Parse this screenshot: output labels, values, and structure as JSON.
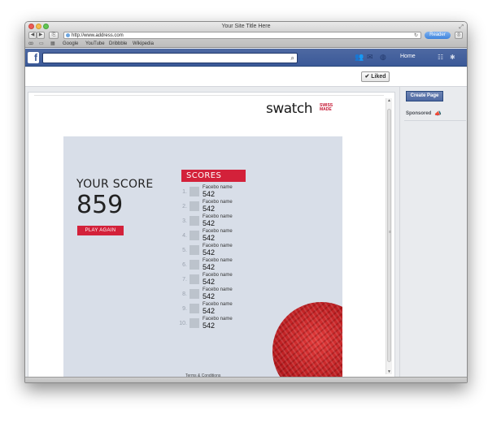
{
  "browser": {
    "window_title": "Your Site Title Here",
    "url": "http://www.address.com",
    "reader_label": "Reader",
    "bookmarks": [
      "Google",
      "YouTube",
      "Dribbble",
      "Wikipedia"
    ]
  },
  "facebook": {
    "logo_letter": "f",
    "search_placeholder": "",
    "home_label": "Home",
    "liked_label": "✔ Liked",
    "create_page_label": "Create Page",
    "sponsored_label": "Sponsored"
  },
  "brand": {
    "logo_word": "swatch",
    "logo_sub_1": "SWISS",
    "logo_sub_2": "MADE"
  },
  "game": {
    "score_title": "YOUR SCORE",
    "score_value": "859",
    "play_again_label": "PLAY AGAIN",
    "scores_tab_label": "SCORES",
    "leaderboard": [
      {
        "rank": "1.",
        "name": "Facebo name",
        "score": "542"
      },
      {
        "rank": "2.",
        "name": "Facebo name",
        "score": "542"
      },
      {
        "rank": "3.",
        "name": "Facebo name",
        "score": "542"
      },
      {
        "rank": "4.",
        "name": "Facebo name",
        "score": "542"
      },
      {
        "rank": "5.",
        "name": "Facebo name",
        "score": "542"
      },
      {
        "rank": "6.",
        "name": "Facebo name",
        "score": "542"
      },
      {
        "rank": "7.",
        "name": "Facebo name",
        "score": "542"
      },
      {
        "rank": "8.",
        "name": "Facebo name",
        "score": "542"
      },
      {
        "rank": "9.",
        "name": "Facebo name",
        "score": "542"
      },
      {
        "rank": "10.",
        "name": "Facebo name",
        "score": "542"
      }
    ],
    "terms_label": "Terms & Conditions"
  },
  "colors": {
    "facebook_blue": "#3b5998",
    "accent_red": "#d3213a",
    "app_background": "#d8dee8"
  },
  "icons": {
    "browser": [
      "back-icon",
      "forward-icon",
      "share-icon",
      "globe-icon",
      "reload-icon",
      "download-icon"
    ],
    "facebook": [
      "friends-icon",
      "messages-icon",
      "notifications-icon",
      "search-icon",
      "settings-icon"
    ]
  }
}
